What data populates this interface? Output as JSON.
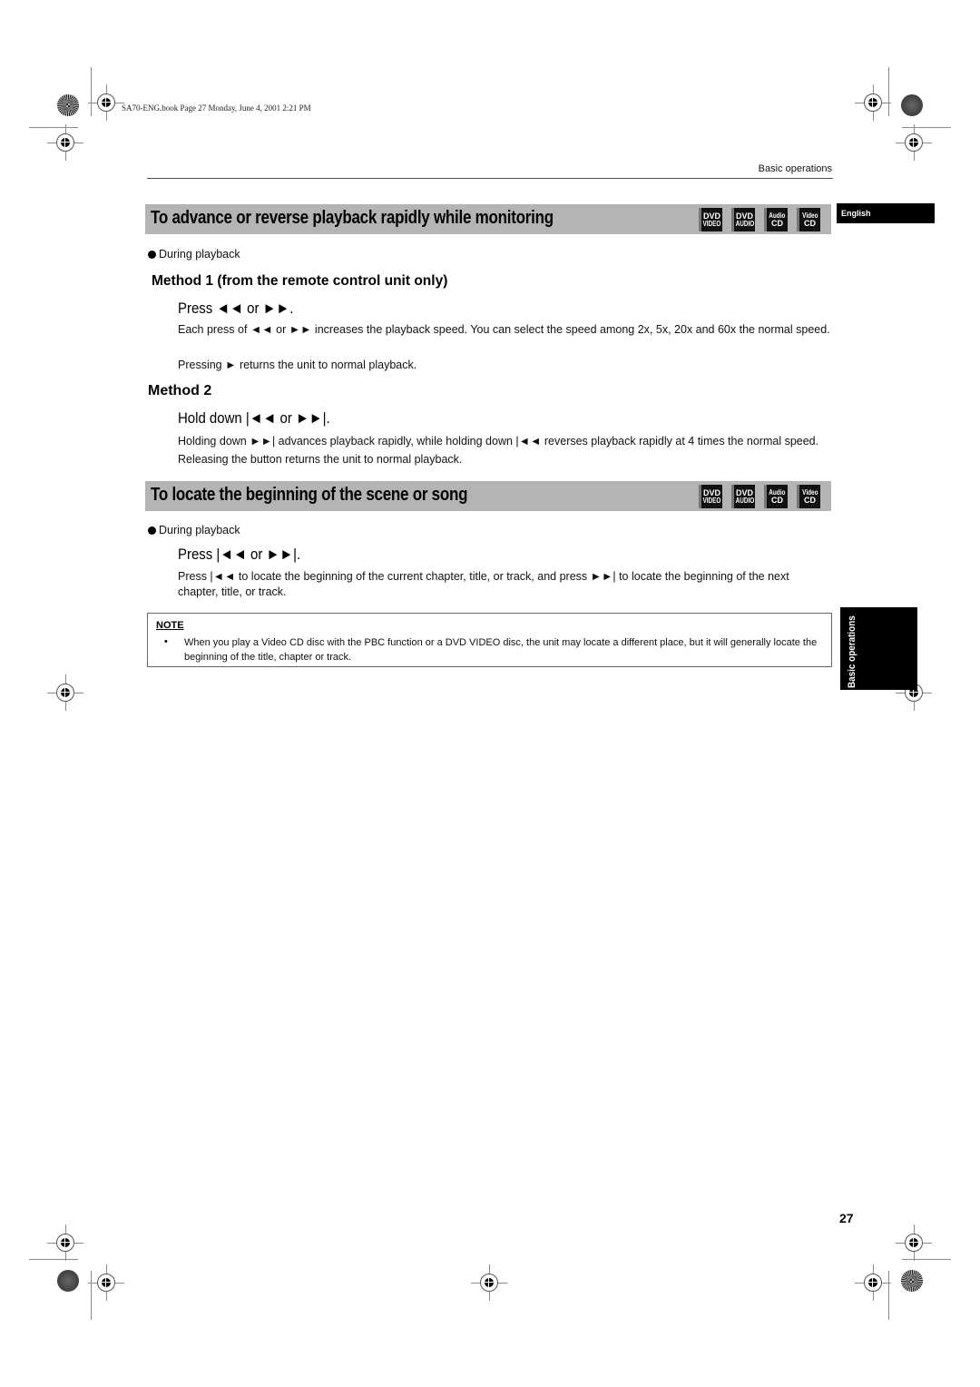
{
  "header": {
    "file_meta": "SA70-ENG.book  Page 27  Monday, June 4, 2001  2:21 PM",
    "running_head": "Basic operations",
    "language_tab": "English"
  },
  "badges": [
    {
      "top": "DVD",
      "bottom": "VIDEO",
      "icon": "dvd-video-icon"
    },
    {
      "top": "DVD",
      "bottom": "AUDIO",
      "icon": "dvd-audio-icon"
    },
    {
      "top": "Audio",
      "bottom": "CD",
      "icon": "audio-cd-icon"
    },
    {
      "top": "Video",
      "bottom": "CD",
      "icon": "video-cd-icon"
    }
  ],
  "section1": {
    "title": "To advance or reverse playback rapidly while monitoring",
    "condition": "During playback",
    "method1": {
      "heading": "Method 1 (from the remote control unit only)",
      "step": "Press ◄◄ or ►►.",
      "body1": "Each press of ◄◄ or ►► increases the playback speed. You can select the speed among 2x, 5x, 20x and 60x the normal speed.",
      "body2": "Pressing ► returns the unit to normal playback."
    },
    "method2": {
      "heading": "Method 2",
      "step": "Hold down |◄◄ or ►►|.",
      "body": "Holding down ►►| advances playback rapidly, while holding down |◄◄ reverses playback rapidly at 4 times the normal speed. Releasing the button returns the unit to normal playback."
    }
  },
  "section2": {
    "title": "To locate the beginning of the scene or song",
    "condition": "During playback",
    "step": "Press |◄◄ or ►►|.",
    "body": "Press |◄◄ to locate the beginning of the current chapter, title, or track, and press ►►| to locate the beginning of the next chapter, title, or track."
  },
  "note": {
    "label": "NOTE",
    "bullet": "•",
    "text": "When you play a Video CD disc with the PBC function or a DVD VIDEO disc, the unit may locate a different place, but it will generally locate the beginning of the title, chapter or track."
  },
  "side_tab": "Basic operations",
  "page_number": "27"
}
